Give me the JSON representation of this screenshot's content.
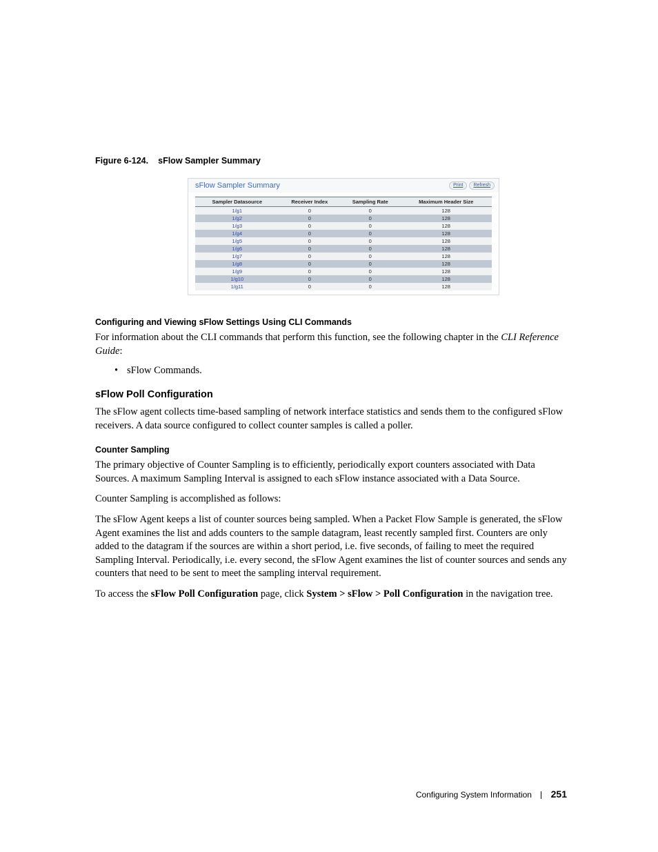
{
  "figure": {
    "id": "Figure 6-124.",
    "title": "sFlow Sampler Summary"
  },
  "pane": {
    "title": "sFlow Sampler Summary",
    "print_label": "Print",
    "refresh_label": "Refresh",
    "columns": {
      "datasource": "Sampler Datasource",
      "receiver": "Receiver Index",
      "rate": "Sampling Rate",
      "maxhdr": "Maximum Header Size"
    },
    "rows": [
      {
        "ds": "1/g1",
        "ri": "0",
        "sr": "0",
        "mh": "128"
      },
      {
        "ds": "1/g2",
        "ri": "0",
        "sr": "0",
        "mh": "128"
      },
      {
        "ds": "1/g3",
        "ri": "0",
        "sr": "0",
        "mh": "128"
      },
      {
        "ds": "1/g4",
        "ri": "0",
        "sr": "0",
        "mh": "128"
      },
      {
        "ds": "1/g5",
        "ri": "0",
        "sr": "0",
        "mh": "128"
      },
      {
        "ds": "1/g6",
        "ri": "0",
        "sr": "0",
        "mh": "128"
      },
      {
        "ds": "1/g7",
        "ri": "0",
        "sr": "0",
        "mh": "128"
      },
      {
        "ds": "1/g8",
        "ri": "0",
        "sr": "0",
        "mh": "128"
      },
      {
        "ds": "1/g9",
        "ri": "0",
        "sr": "0",
        "mh": "128"
      },
      {
        "ds": "1/g10",
        "ri": "0",
        "sr": "0",
        "mh": "128"
      },
      {
        "ds": "1/g11",
        "ri": "0",
        "sr": "0",
        "mh": "128"
      }
    ]
  },
  "sections": {
    "cli_heading": "Configuring and Viewing sFlow Settings Using CLI Commands",
    "cli_para_1": "For information about the CLI commands that perform this function, see the following chapter in the ",
    "cli_ref_italic": "CLI Reference Guide",
    "cli_para_1_tail": ":",
    "cli_bullet": "sFlow Commands.",
    "poll_heading": "sFlow Poll Configuration",
    "poll_para": "The sFlow agent collects time-based sampling of network interface statistics and sends them to the configured sFlow receivers. A data source configured to collect counter samples is called a poller.",
    "counter_heading": "Counter Sampling",
    "counter_para_1": "The primary objective of Counter Sampling is to efficiently, periodically export counters associated with Data Sources. A maximum Sampling Interval is assigned to each sFlow instance associated with a Data Source.",
    "counter_para_2": "Counter Sampling is accomplished as follows:",
    "counter_para_3": "The sFlow Agent keeps a list of counter sources being sampled. When a Packet Flow Sample is generated, the sFlow Agent examines the list and adds counters to the sample datagram, least recently sampled first. Counters are only added to the datagram if the sources are within a short period, i.e. five seconds, of failing to meet the required Sampling Interval. Periodically, i.e. every second, the sFlow Agent examines the list of counter sources and sends any counters that need to be sent to meet the sampling interval requirement.",
    "access_pre": "To access the ",
    "access_strong1": "sFlow Poll Configuration",
    "access_mid": " page, click ",
    "access_strong2": "System > sFlow > Poll Configuration",
    "access_tail": " in the navigation tree."
  },
  "footer": {
    "section": "Configuring System Information",
    "page": "251"
  }
}
